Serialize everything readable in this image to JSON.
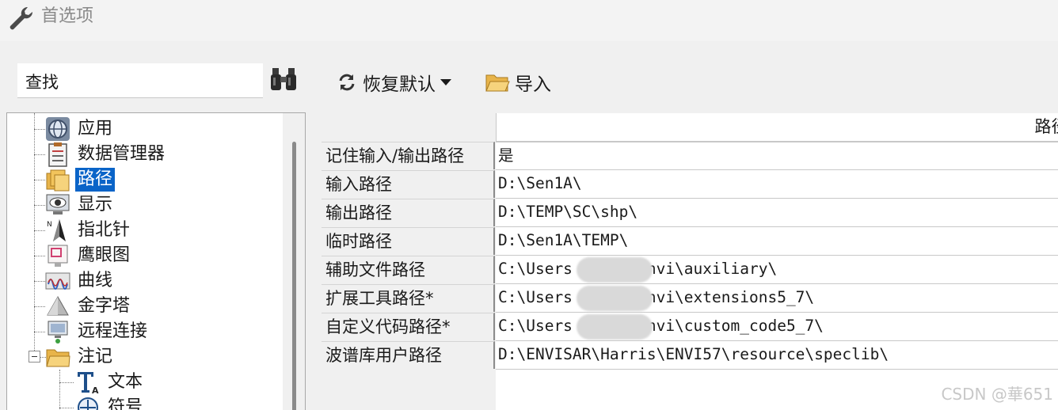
{
  "window": {
    "title": "首选项",
    "icon": "wrench-icon"
  },
  "search": {
    "placeholder": "查找",
    "button_icon": "binoculars-icon"
  },
  "toolbar": {
    "restore_label": "恢复默认",
    "restore_icon": "refresh-icon",
    "import_label": "导入",
    "import_icon": "open-folder-icon"
  },
  "tree": {
    "selected": "路径",
    "items": [
      {
        "label": "应用",
        "icon": "globe-icon"
      },
      {
        "label": "数据管理器",
        "icon": "clipboard-icon"
      },
      {
        "label": "路径",
        "icon": "folders-icon"
      },
      {
        "label": "显示",
        "icon": "eye-monitor-icon"
      },
      {
        "label": "指北针",
        "icon": "north-arrow-icon"
      },
      {
        "label": "鹰眼图",
        "icon": "overview-icon"
      },
      {
        "label": "曲线",
        "icon": "curve-icon"
      },
      {
        "label": "金字塔",
        "icon": "pyramid-icon"
      },
      {
        "label": "远程连接",
        "icon": "remote-connection-icon"
      },
      {
        "label": "注记",
        "icon": "folder-icon"
      },
      {
        "label": "文本",
        "icon": "text-tool-icon"
      },
      {
        "label": "符号",
        "icon": "symbol-icon"
      }
    ]
  },
  "table": {
    "column_header": "路径",
    "rows": [
      {
        "label": "记住输入/输出路径",
        "value": "是"
      },
      {
        "label": "输入路径",
        "value": "D:\\Sen1A\\"
      },
      {
        "label": "输出路径",
        "value": "D:\\TEMP\\SC\\shp\\"
      },
      {
        "label": "临时路径",
        "value": "D:\\Sen1A\\TEMP\\"
      },
      {
        "label": "辅助文件路径",
        "value": "C:\\Users        \\.idl\\envi\\auxiliary\\"
      },
      {
        "label": "扩展工具路径*",
        "value": "C:\\Users        \\.idl\\envi\\extensions5_7\\"
      },
      {
        "label": "自定义代码路径*",
        "value": "C:\\Users        \\.idl\\envi\\custom_code5_7\\"
      },
      {
        "label": "波谱库用户路径",
        "value": "D:\\ENVISAR\\Harris\\ENVI57\\resource\\speclib\\"
      }
    ]
  },
  "watermark": "CSDN @華651",
  "colors": {
    "selection": "#0a64c8",
    "background": "#f0f0f0"
  }
}
